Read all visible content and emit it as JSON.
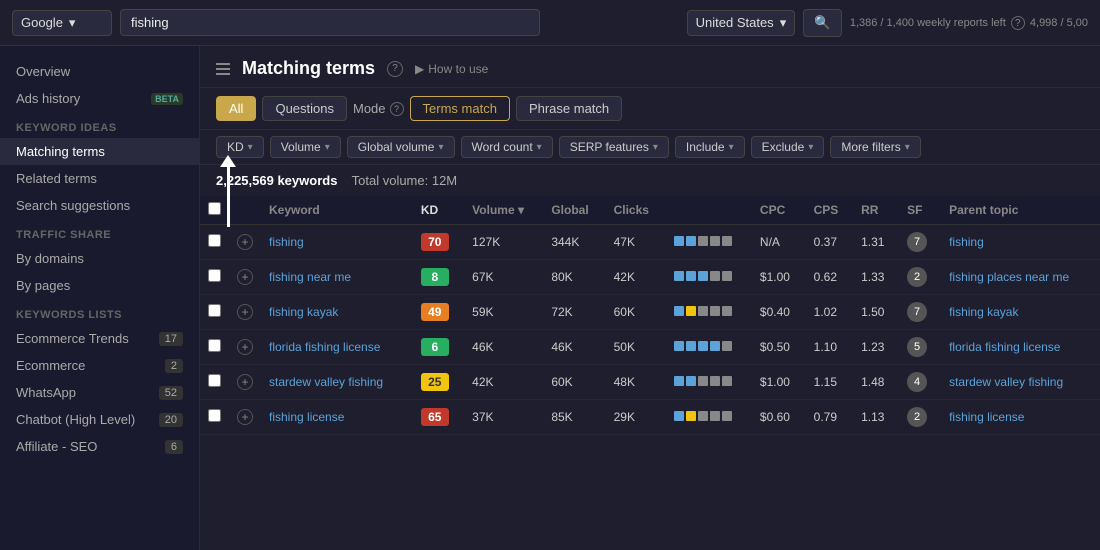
{
  "topbar": {
    "engine": "Google",
    "engine_chevron": "▾",
    "query": "fishing",
    "country": "United States",
    "country_chevron": "▾",
    "reports_text": "1,386 / 1,400 weekly reports left",
    "credits_text": "4,998 / 5,00",
    "help_icon": "?"
  },
  "sidebar": {
    "nav_items": [
      {
        "label": "Overview",
        "active": false,
        "badge": ""
      },
      {
        "label": "Ads history",
        "active": false,
        "badge": "BETA"
      }
    ],
    "keyword_ideas_section": "Keyword ideas",
    "keyword_ideas": [
      {
        "label": "Matching terms",
        "active": true,
        "badge": ""
      },
      {
        "label": "Related terms",
        "active": false,
        "badge": ""
      },
      {
        "label": "Search suggestions",
        "active": false,
        "badge": ""
      }
    ],
    "traffic_share_section": "Traffic share",
    "traffic_share": [
      {
        "label": "By domains",
        "active": false,
        "badge": ""
      },
      {
        "label": "By pages",
        "active": false,
        "badge": ""
      }
    ],
    "keywords_lists_section": "Keywords lists",
    "keywords_lists": [
      {
        "label": "Ecommerce Trends",
        "badge": "17"
      },
      {
        "label": "Ecommerce",
        "badge": "2"
      },
      {
        "label": "WhatsApp",
        "badge": "52"
      },
      {
        "label": "Chatbot (High Level)",
        "badge": "20"
      },
      {
        "label": "Affiliate - SEO",
        "badge": "6"
      }
    ]
  },
  "page": {
    "title": "Matching terms",
    "how_to_use": "How to use",
    "tabs": {
      "all": "All",
      "questions": "Questions",
      "mode": "Mode",
      "terms_match": "Terms match",
      "phrase_match": "Phrase match"
    },
    "col_filters": [
      "KD",
      "Volume",
      "Global volume",
      "Word count",
      "SERP features",
      "Include",
      "Exclude",
      "More filters"
    ],
    "results_count": "2,225,569 keywords",
    "total_volume": "Total volume: 12M"
  },
  "table": {
    "headers": [
      "",
      "",
      "Keyword",
      "KD",
      "Volume",
      "Global",
      "Clicks",
      "",
      "CPC",
      "CPS",
      "RR",
      "SF",
      "Parent topic"
    ],
    "rows": [
      {
        "keyword": "fishing",
        "kd": "70",
        "kd_class": "kd-70",
        "volume": "127K",
        "global": "344K",
        "clicks": "47K",
        "cpc": "N/A",
        "cps": "0.37",
        "rr": "1.31",
        "sf": "7",
        "parent_topic": "fishing",
        "bar_colors": [
          "#5ba3d9",
          "#5ba3d9",
          "#888",
          "#888",
          "#888"
        ]
      },
      {
        "keyword": "fishing near me",
        "kd": "8",
        "kd_class": "kd-8",
        "volume": "67K",
        "global": "80K",
        "clicks": "42K",
        "cpc": "$1.00",
        "cps": "0.62",
        "rr": "1.33",
        "sf": "2",
        "parent_topic": "fishing places near me",
        "bar_colors": [
          "#5ba3d9",
          "#5ba3d9",
          "#5ba3d9",
          "#888",
          "#888"
        ]
      },
      {
        "keyword": "fishing kayak",
        "kd": "49",
        "kd_class": "kd-49",
        "volume": "59K",
        "global": "72K",
        "clicks": "60K",
        "cpc": "$0.40",
        "cps": "1.02",
        "rr": "1.50",
        "sf": "7",
        "parent_topic": "fishing kayak",
        "bar_colors": [
          "#5ba3d9",
          "#f1c40f",
          "#888",
          "#888",
          "#888"
        ]
      },
      {
        "keyword": "florida fishing license",
        "kd": "6",
        "kd_class": "kd-6",
        "volume": "46K",
        "global": "46K",
        "clicks": "50K",
        "cpc": "$0.50",
        "cps": "1.10",
        "rr": "1.23",
        "sf": "5",
        "parent_topic": "florida fishing license",
        "bar_colors": [
          "#5ba3d9",
          "#5ba3d9",
          "#5ba3d9",
          "#5ba3d9",
          "#888"
        ]
      },
      {
        "keyword": "stardew valley fishing",
        "kd": "25",
        "kd_class": "kd-25",
        "volume": "42K",
        "global": "60K",
        "clicks": "48K",
        "cpc": "$1.00",
        "cps": "1.15",
        "rr": "1.48",
        "sf": "4",
        "parent_topic": "stardew valley fishing",
        "bar_colors": [
          "#5ba3d9",
          "#5ba3d9",
          "#888",
          "#888",
          "#888"
        ]
      },
      {
        "keyword": "fishing license",
        "kd": "65",
        "kd_class": "kd-65",
        "volume": "37K",
        "global": "85K",
        "clicks": "29K",
        "cpc": "$0.60",
        "cps": "0.79",
        "rr": "1.13",
        "sf": "2",
        "parent_topic": "fishing license",
        "bar_colors": [
          "#5ba3d9",
          "#f1c40f",
          "#888",
          "#888",
          "#888"
        ]
      }
    ]
  }
}
